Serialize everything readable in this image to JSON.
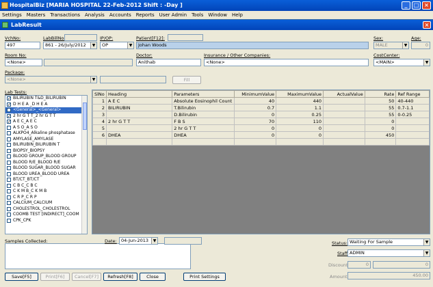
{
  "app": {
    "title": "HospitalBiz [MARIA HOSPITAL 22-Feb-2012  Shift : -Day ]"
  },
  "menu": [
    "Settings",
    "Masters",
    "Transactions",
    "Analysis",
    "Accounts",
    "Reports",
    "User Admin",
    "Tools",
    "Window",
    "Help"
  ],
  "window": {
    "title": "LabResult"
  },
  "form": {
    "vchno_label": "VchNo:",
    "vchno": "497",
    "labbillno_label": "LabBillNo:",
    "labbillno": "861 - 26/July/2012",
    "ipop_label": "IP/OP:",
    "ipop": "OP",
    "patient_label": "Patient[F12]:",
    "patient": "Johan Woods",
    "sex_label": "Sex:",
    "sex": "MALE",
    "age_label": "Age:",
    "age": "0",
    "roomno_label": "Room No:",
    "roomno": "<None>",
    "doctor_label": "Doctor:",
    "doctor": "Anithab",
    "insurance_label": "Insurance / Other Companies:",
    "insurance": "<None>",
    "costcenter_label": "CostCenter:",
    "costcenter": "<MAIN>",
    "package_label": "Package:",
    "package": "<None>",
    "fill_label": "Fill",
    "labtests_label": "Lab Tests:",
    "samples_label": "Samples Collected:",
    "date_label": "Date:",
    "date": "04-Jun-2013",
    "status_label": "Status:",
    "status": "Waiting For Sample",
    "staff_label": "Staff",
    "staff": "ADMIN",
    "discount_label": "Discount:",
    "discount": "0",
    "discount2": "0",
    "amount_label": "Amount:",
    "amount": "450.00"
  },
  "lab_tests": [
    {
      "label": "BILIRUBIN T&D_BILIRUBIN",
      "checked": true
    },
    {
      "label": "D H E A _D H E A",
      "checked": true
    },
    {
      "label": "<General>_<General>",
      "checked": true,
      "selected": true
    },
    {
      "label": "2 hr G T T_2 hr G T T",
      "checked": true
    },
    {
      "label": "A E C_A E C",
      "checked": true
    },
    {
      "label": "A S O_A S O",
      "checked": false
    },
    {
      "label": "ALKPO4_Alkaline phosphatase",
      "checked": false
    },
    {
      "label": "AMYLASE_AMYLASE",
      "checked": false
    },
    {
      "label": "BILIRUBIN_BILIRUBIN T",
      "checked": false
    },
    {
      "label": "BIOPSY_BIOPSY",
      "checked": false
    },
    {
      "label": "BLOOD GROUP_BLOOD GROUP",
      "checked": false
    },
    {
      "label": "BLOOD R/E_BLOOD R/E",
      "checked": false
    },
    {
      "label": "BLOOD SUGAR_BLOOD SUGAR",
      "checked": false
    },
    {
      "label": "BLOOD UREA_BLOOD UREA",
      "checked": false
    },
    {
      "label": "BT/CT_BT/CT",
      "checked": false
    },
    {
      "label": "C B C_C B C",
      "checked": false
    },
    {
      "label": "C K M B_C K M B",
      "checked": false
    },
    {
      "label": "C R P_C R P",
      "checked": false
    },
    {
      "label": "CALCIUM_CALCIUM",
      "checked": false
    },
    {
      "label": "CHOLESTROL_CHOLESTROL",
      "checked": false
    },
    {
      "label": "COOMB TEST [INDIRECT]_COOM",
      "checked": false
    },
    {
      "label": "CPK_CPK",
      "checked": false
    }
  ],
  "grid": {
    "headers": [
      "SlNo",
      "Heading",
      "Parameters",
      "MinimumValue",
      "MaximumValue",
      "ActualValue",
      "Rate",
      "Ref Range"
    ],
    "rows": [
      [
        "1",
        "A E C",
        "Absolute Eosinophil Count",
        "40",
        "440",
        "",
        "50",
        "40-440"
      ],
      [
        "2",
        "BILIRUBIN",
        "T.Bilirubin",
        "0.7",
        "1.1",
        "",
        "55",
        "0.7-1.1"
      ],
      [
        "3",
        "",
        "D.Bilirubin",
        "0",
        "0.25",
        "",
        "55",
        "0-0.25"
      ],
      [
        "4",
        "2 hr G T T",
        "F B S",
        "70",
        "110",
        "",
        "0",
        ""
      ],
      [
        "5",
        "",
        "2 hr G T T",
        "0",
        "0",
        "",
        "0",
        ""
      ],
      [
        "6",
        "DHEA",
        "DHEA",
        "0",
        "0",
        "",
        "450",
        ""
      ],
      [
        "",
        "",
        "",
        "",
        "",
        "",
        "",
        ""
      ]
    ]
  },
  "buttons": {
    "save": "Save[F5]",
    "print": "Print[F6]",
    "cancel": "Cancel[F7]",
    "refresh": "Refresh[F8]",
    "close": "Close",
    "print_settings": "Print Settings"
  }
}
